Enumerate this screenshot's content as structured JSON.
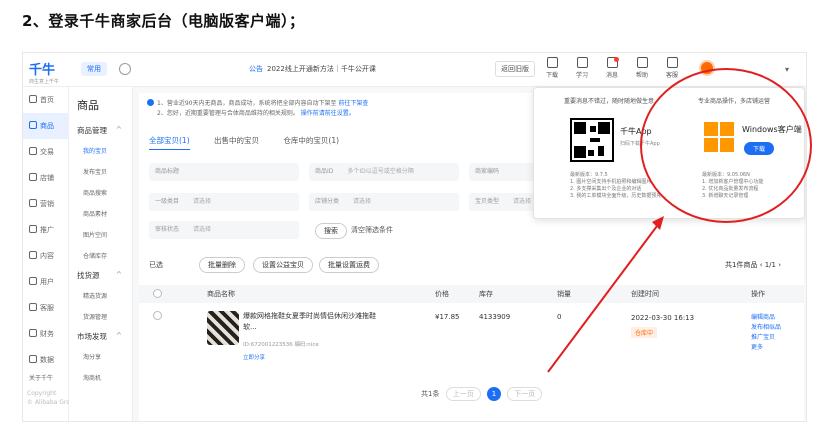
{
  "heading": "2、登录千牛商家后台（电脑版客户端）；",
  "topbar": {
    "logo": "千牛",
    "logo_sub": "商生意上千牛",
    "tag": "常用",
    "notice_label": "公告",
    "notice_text": "2022线上开通新方法｜千牛公开课",
    "old_button": "返回旧版",
    "tools": [
      "下载",
      "学习",
      "消息",
      "帮助",
      "客服"
    ],
    "caret": "▾"
  },
  "nav": {
    "items": [
      "首页",
      "商品",
      "交易",
      "店铺",
      "营销",
      "推广",
      "内容",
      "用户",
      "客服",
      "财务",
      "数据"
    ],
    "active_index": 1,
    "more": "关于千牛",
    "copyright": "Copyright\n© Alibaba Group"
  },
  "submenu": {
    "title": "商品",
    "group1": "商品管理",
    "group1_items": [
      "我的宝贝",
      "发布宝贝",
      "商品搜索",
      "商品素材",
      "图片空间",
      "仓储库存"
    ],
    "group2": "找货源",
    "group2_items": [
      "精选货源",
      "货源管理"
    ],
    "group3": "市场发现",
    "group3_items": [
      "淘分享",
      "淘商机"
    ],
    "arrow": "^"
  },
  "main": {
    "tip1": "1、营业近90天内无商品，商品成功，系统将把全部内容自动下架至",
    "tip1_link": "前往下架查",
    "tip2": "2、您好，近期重要管理与合体商品维持的相关规则。",
    "tip2_link": "操作前请前往设置。",
    "tabs": [
      "全部宝贝(1)",
      "出售中的宝贝",
      "仓库中的宝贝(1)"
    ],
    "filters": [
      {
        "label": "商品标题",
        "value": ""
      },
      {
        "label": "商品ID",
        "value": "多个ID以逗号或空格分隔"
      },
      {
        "label": "商家编码",
        "value": ""
      },
      {
        "label": "一级类目",
        "value": "请选择"
      },
      {
        "label": "店铺分类",
        "value": "请选择"
      },
      {
        "label": "宝贝类型",
        "value": "请选择"
      },
      {
        "label": "审核状态",
        "value": "请选择"
      }
    ],
    "search_button": "搜索",
    "clear_link": "清空筛选条件",
    "selected_label": "已选",
    "batch_buttons": [
      "批量删除",
      "设置公益宝贝",
      "批量设置运费"
    ],
    "total": "共1件商品",
    "page_small": "1/1",
    "columns": [
      "商品名称",
      "价格",
      "库存",
      "销量",
      "创建时间",
      "操作"
    ],
    "row": {
      "name": "爆款网格拖鞋女夏季时尚情侣休闲沙滩拖鞋软...",
      "id": "ID:672001223536 编码:nice",
      "share": "立即分享",
      "price": "¥17.85",
      "stock": "4133909",
      "sales": "0",
      "time": "2022-03-30 16:13",
      "status": "仓库中",
      "ops": [
        "编辑商品",
        "发布相似品",
        "推广宝贝",
        "更多"
      ]
    },
    "pager": {
      "total": "共1条",
      "prev": "上一页",
      "current": "1",
      "next": "下一页"
    }
  },
  "popup": {
    "col1_title": "重要消息不错过，随时随地做生意",
    "app_name": "千牛App",
    "app_sub": "扫码下载千牛App",
    "ver1": "最新版本：9.7.5\n1. 图片空间支持手机拍照和编辑图片\n2. 多支撑采集出个及企业的对话\n3. 我的工单模块全面升级，历史数据预先...",
    "col2_title": "专业商品操作，多店铺运营",
    "win_name": "Windows客户端",
    "download": "下载",
    "ver2": "最新版本：9.05.06N\n1. 增加新客户管理中心功能\n2. 优化商品批量发布流程\n3. 新增聊天记录管理"
  },
  "colors": {
    "accent": "#1d6ef5",
    "circle": "#e02020",
    "windows": "#ff9800"
  }
}
